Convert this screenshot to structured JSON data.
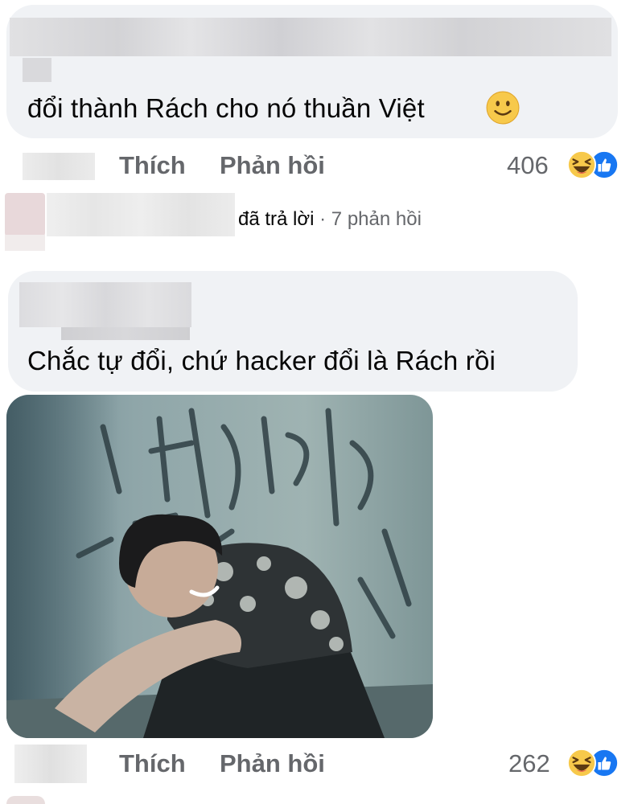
{
  "comment1": {
    "text": "đổi thành Rách cho nó thuần Việt",
    "emoji": "slightly-smiling-face-icon",
    "actions": {
      "like_label": "Thích",
      "reply_label": "Phản hồi"
    },
    "reaction_count": "406",
    "reactions": [
      "haha-icon",
      "like-icon"
    ]
  },
  "replies_row": {
    "replied_label": "đã trả lời",
    "separator": "·",
    "replies_count": "7 phản hồi"
  },
  "comment2": {
    "text": "Chắc tự đổi, chứ hacker đổi là Rách rồi",
    "actions": {
      "like_label": "Thích",
      "reply_label": "Phản hồi"
    },
    "reaction_count": "262",
    "reactions": [
      "haha-icon",
      "like-icon"
    ]
  },
  "colors": {
    "bubble": "#f0f2f5",
    "text": "#050505",
    "secondary_text": "#65676b",
    "like_blue": "#1877f2",
    "haha_yellow": "#f7c94b"
  }
}
